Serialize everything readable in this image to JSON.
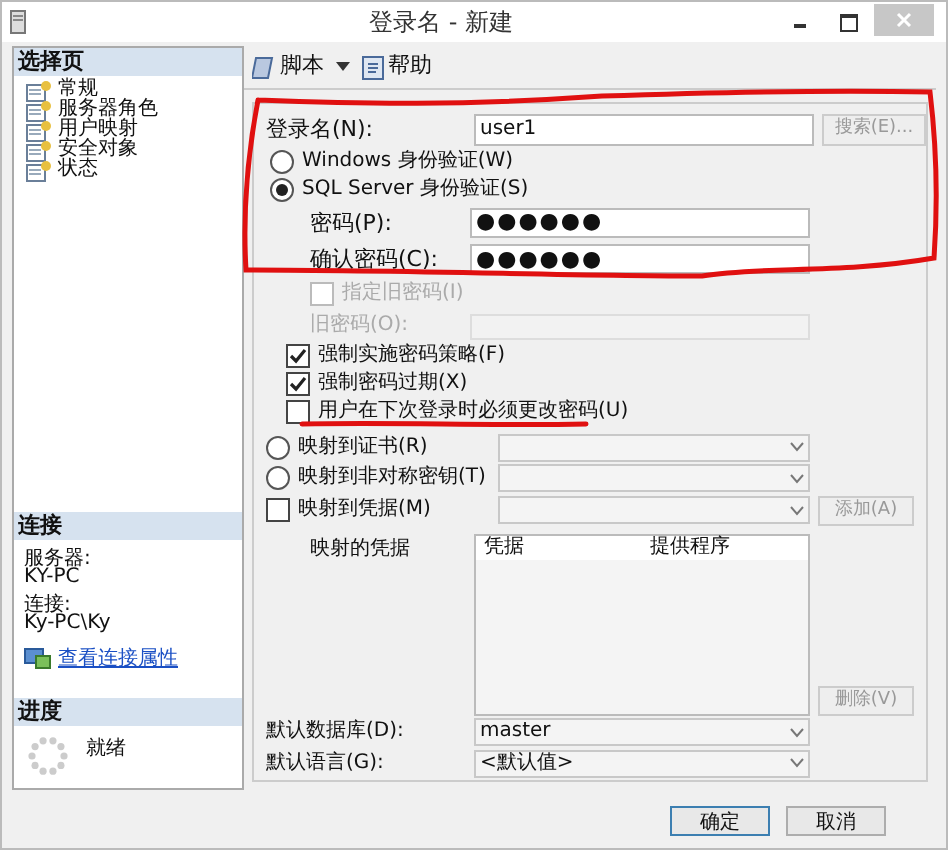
{
  "window": {
    "title": "登录名 - 新建"
  },
  "select_page": {
    "header": "选择页",
    "items": [
      {
        "label": "常规"
      },
      {
        "label": "服务器角色"
      },
      {
        "label": "用户映射"
      },
      {
        "label": "安全对象"
      },
      {
        "label": "状态"
      }
    ]
  },
  "connection": {
    "header": "连接",
    "server_label": "服务器:",
    "server": "KY-PC",
    "conn_label": "连接:",
    "conn": "Ky-PC\\Ky",
    "link": "查看连接属性"
  },
  "progress": {
    "header": "进度",
    "status": "就绪"
  },
  "toolbar": {
    "script": "脚本",
    "help": "帮助"
  },
  "login_name": {
    "label": "登录名(N):",
    "value": "user1",
    "search": "搜索(E)...",
    "search_disabled": true
  },
  "auth": [
    {
      "label": "Windows 身份验证(W)",
      "selected": false
    },
    {
      "label": "SQL Server 身份验证(S)",
      "selected": true
    }
  ],
  "password": {
    "label": "密码(P):",
    "value": "●●●●●●"
  },
  "confirm_password": {
    "label": "确认密码(C):",
    "value": "●●●●●●"
  },
  "old_password_check": {
    "label": "指定旧密码(I)",
    "checked": false,
    "disabled": true
  },
  "old_password": {
    "label": "旧密码(O):",
    "disabled": true
  },
  "policies": [
    {
      "label": "强制实施密码策略(F)",
      "checked": true,
      "disabled": false
    },
    {
      "label": "强制密码过期(X)",
      "checked": true,
      "disabled": false
    },
    {
      "label": "用户在下次登录时必须更改密码(U)",
      "checked": false,
      "disabled": false
    }
  ],
  "mappings": [
    {
      "kind": "radio",
      "label": "映射到证书(R)",
      "selected": false
    },
    {
      "kind": "radio",
      "label": "映射到非对称密钥(T)",
      "selected": false
    },
    {
      "kind": "checkbox",
      "label": "映射到凭据(M)",
      "checked": false
    }
  ],
  "add_button": {
    "label": "添加(A)",
    "disabled": true
  },
  "mapped_credentials": {
    "label": "映射的凭据",
    "columns": [
      "凭据",
      "提供程序"
    ]
  },
  "remove_button": {
    "label": "删除(V)",
    "disabled": true
  },
  "default_database": {
    "label": "默认数据库(D):",
    "value": "master"
  },
  "default_language": {
    "label": "默认语言(G):",
    "value": "<默认值>"
  },
  "buttons": [
    {
      "label": "确定",
      "primary": true
    },
    {
      "label": "取消",
      "primary": false
    }
  ]
}
